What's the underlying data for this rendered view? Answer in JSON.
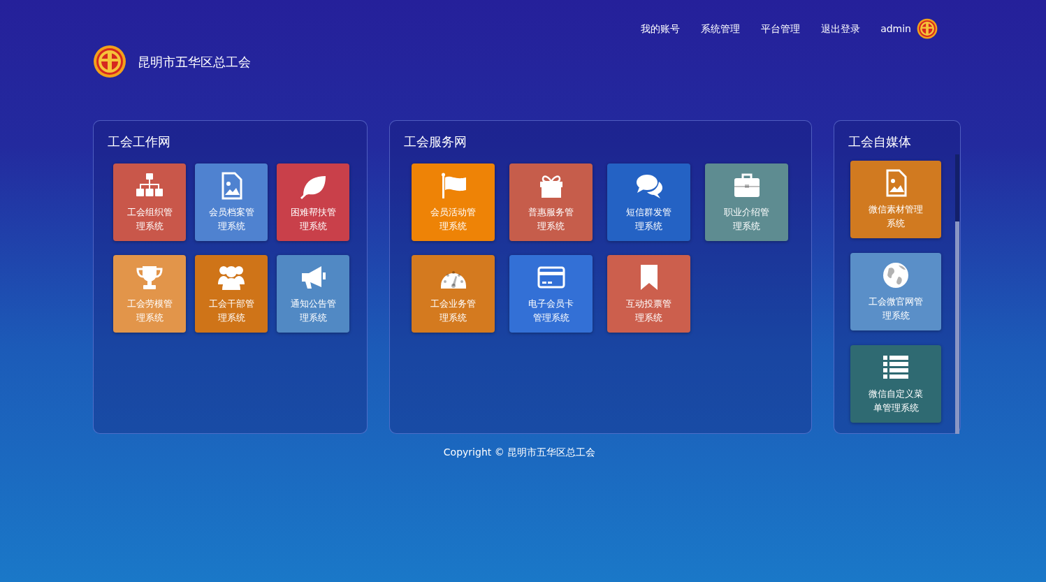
{
  "header": {
    "nav": [
      "我的账号",
      "系统管理",
      "平台管理",
      "退出登录"
    ],
    "user": "admin",
    "org_name": "昆明市五华区总工会"
  },
  "panels": [
    {
      "title": "工会工作网",
      "tiles": [
        {
          "label": "工会组织管理系统",
          "kind": "org",
          "color": "#c9574a"
        },
        {
          "label": "会员档案管理系统",
          "kind": "image",
          "color": "#4f82d0"
        },
        {
          "label": "困难帮扶管理系统",
          "kind": "leaf",
          "color": "#c9404a"
        },
        {
          "label": "工会劳模管理系统",
          "kind": "trophy",
          "color": "#e2954a"
        },
        {
          "label": "工会干部管理系统",
          "kind": "people",
          "color": "#cf7418"
        },
        {
          "label": "通知公告管理系统",
          "kind": "megaphone",
          "color": "#5189c4"
        }
      ]
    },
    {
      "title": "工会服务网",
      "tiles": [
        {
          "label": "会员活动管理系统",
          "kind": "flag",
          "color": "#ee8306"
        },
        {
          "label": "普惠服务管理系统",
          "kind": "gift",
          "color": "#c65d4b"
        },
        {
          "label": "短信群发管理系统",
          "kind": "chat",
          "color": "#2462c4"
        },
        {
          "label": "职业介绍管理系统",
          "kind": "briefcase",
          "color": "#5e8c91"
        },
        {
          "label": "工会业务管理系统",
          "kind": "gauge",
          "color": "#d47a1f"
        },
        {
          "label": "电子会员卡管理系统",
          "kind": "card",
          "color": "#3370d6"
        },
        {
          "label": "互动投票管理系统",
          "kind": "bookmark",
          "color": "#cc5f4d"
        }
      ]
    },
    {
      "title": "工会自媒体",
      "tiles": [
        {
          "label": "微信素材管理系统",
          "kind": "image",
          "color": "#d17a20"
        },
        {
          "label": "工会微官网管理系统",
          "kind": "globe",
          "color": "#5a8fc8"
        },
        {
          "label": "微信自定义菜单管理系统",
          "kind": "list",
          "color": "#2f6a72"
        }
      ]
    }
  ],
  "footer": "Copyright © 昆明市五华区总工会"
}
